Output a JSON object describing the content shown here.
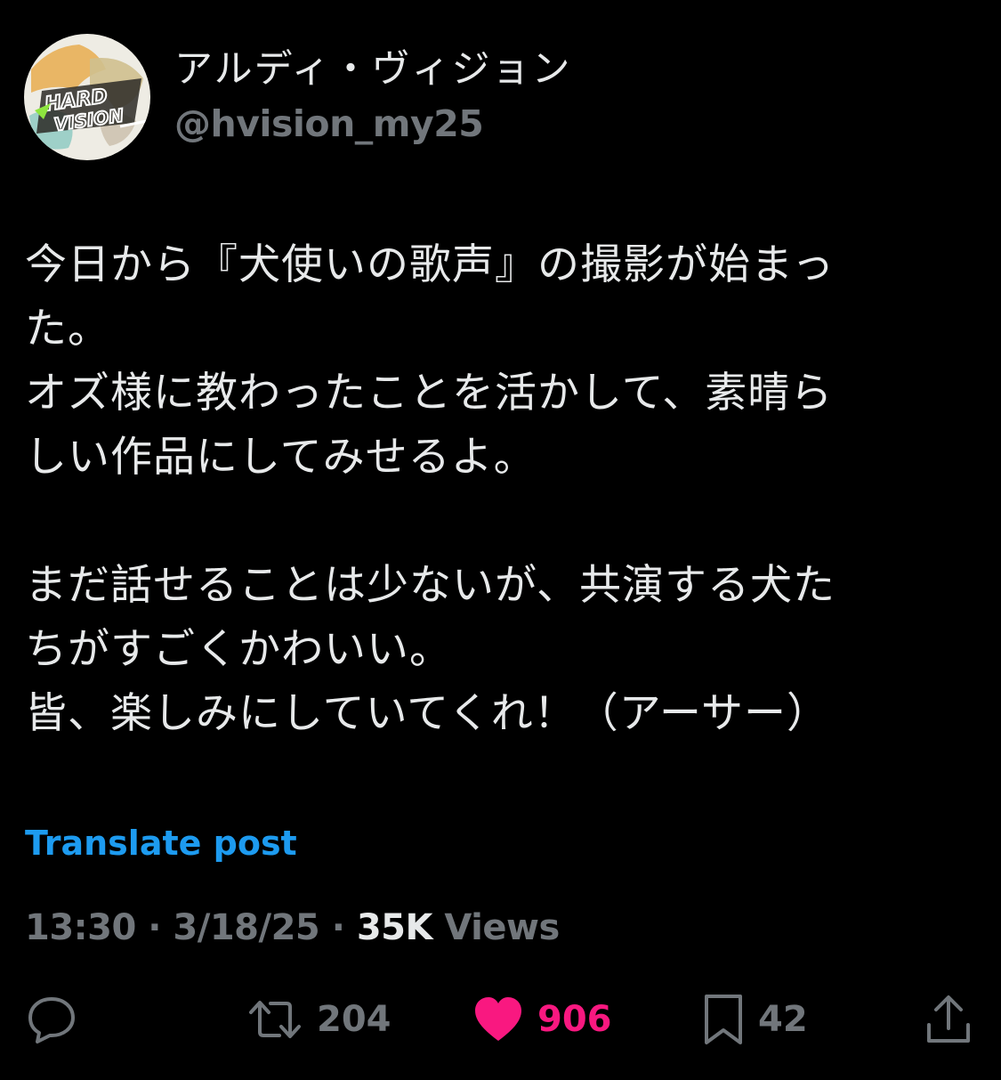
{
  "author": {
    "display_name": "アルディ・ヴィジョン",
    "handle": "@hvision_my25",
    "avatar_icon": "hard-vision-logo-avatar"
  },
  "post": {
    "lines": [
      "今日から『犬使いの歌声』の撮影が始まっ",
      "た。",
      "オズ様に教わったことを活かして、素晴ら",
      "しい作品にしてみせるよ。",
      "",
      "まだ話せることは少ないが、共演する犬た",
      "ちがすごくかわいい。",
      "皆、楽しみにしていてくれ！（アーサー）"
    ],
    "translate_label": "Translate post"
  },
  "meta": {
    "time": "13:30",
    "sep1": " · ",
    "date": "3/18/25",
    "sep2": " · ",
    "views_count": "35K",
    "views_label": " Views"
  },
  "actions": {
    "reply_icon": "speech-bubble-icon",
    "retweet_count": "204",
    "like_count": "906",
    "bookmark_count": "42",
    "share_icon": "upload-icon"
  },
  "colors": {
    "background": "#000000",
    "text": "#e7e9ea",
    "secondary": "#71767b",
    "link": "#1d9bf0",
    "like": "#f91880"
  }
}
